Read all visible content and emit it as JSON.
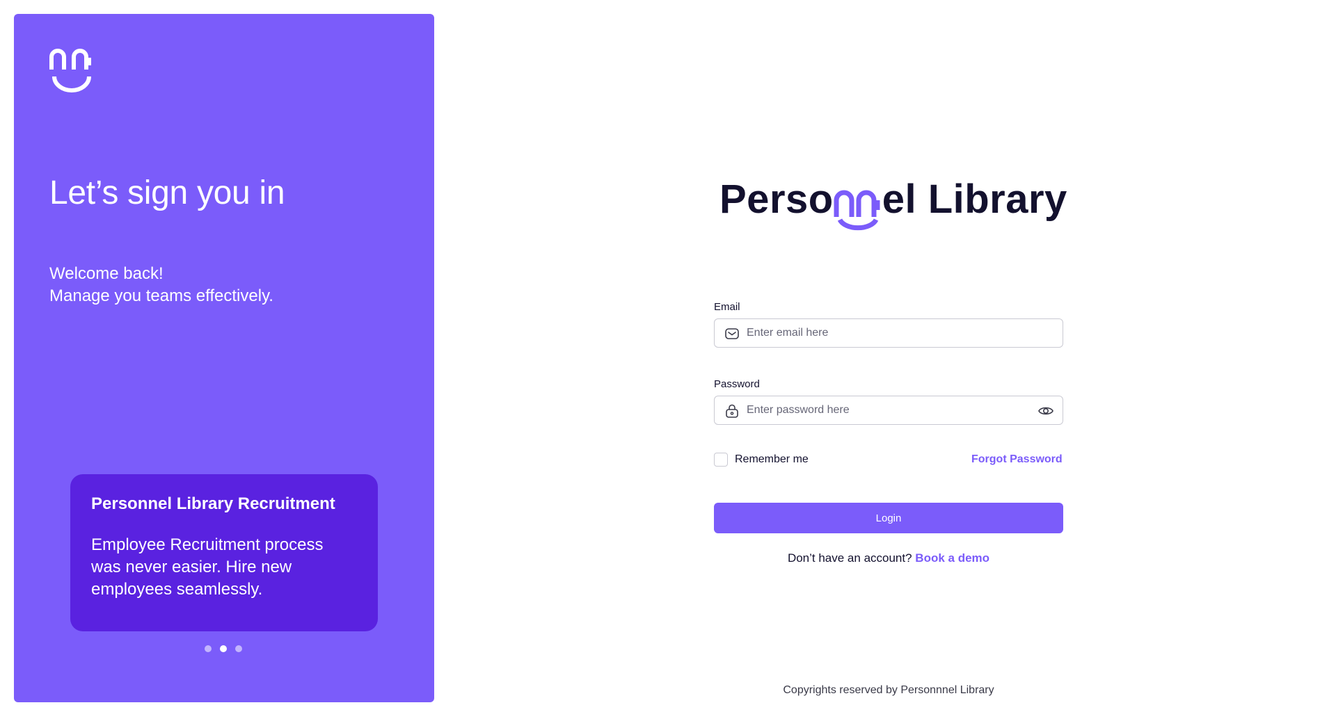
{
  "colors": {
    "accent": "#7b5cfa",
    "card": "#5a22e0",
    "text_dark": "#13112e",
    "border": "#c9c9d2"
  },
  "left_panel": {
    "brand_icon": "smile-logo-icon",
    "headline": "Let’s sign you in",
    "welcome_line1": "Welcome back!",
    "welcome_line2": "Manage you teams effectively.",
    "promo_card": {
      "title": "Personnel Library Recruitment",
      "text": "Employee Recruitment process was never easier. Hire new employees seamlessly."
    },
    "carousel": {
      "total": 3,
      "active_index": 2
    }
  },
  "logo": {
    "part1": "Perso",
    "part2": "el Library"
  },
  "form": {
    "email": {
      "label": "Email",
      "placeholder": "Enter email here",
      "value": "",
      "icon": "mail-icon"
    },
    "password": {
      "label": "Password",
      "placeholder": "Enter password here",
      "value": "",
      "icon": "lock-icon",
      "toggle_icon": "eye-icon"
    },
    "remember_label": "Remember me",
    "remember_checked": false,
    "forgot_label": "Forgot Password",
    "login_label": "Login",
    "signup_prompt": "Don’t have an account?",
    "signup_link": "Book a demo"
  },
  "footer": "Copyrights reserved by Personnnel Library"
}
